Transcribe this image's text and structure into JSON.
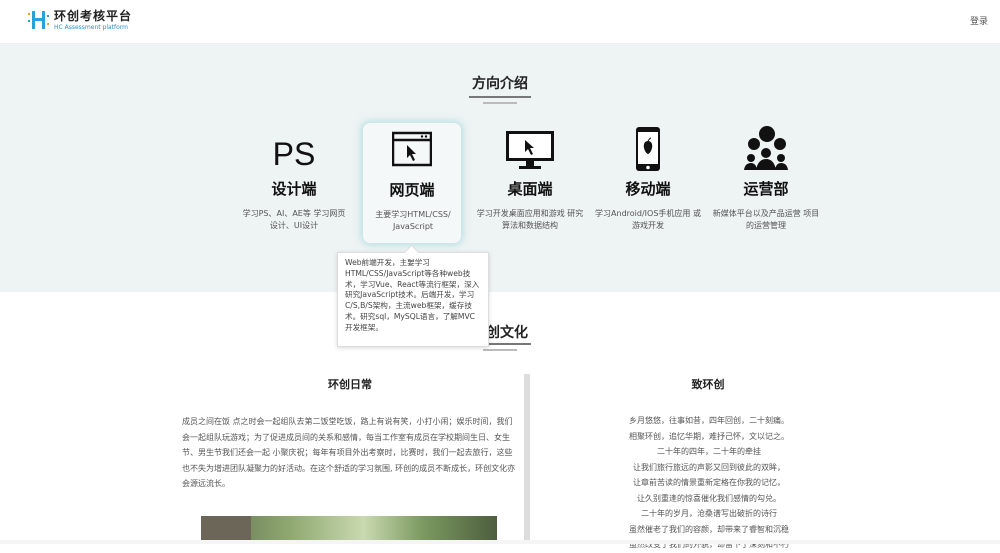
{
  "header": {
    "logo_title": "环创考核平台",
    "logo_subtitle": "HC Assessment platform",
    "login_label": "登录"
  },
  "direction": {
    "title": "方向介绍",
    "cards": [
      {
        "icon": "ps-text-icon",
        "icon_text": "PS",
        "name": "设计端",
        "desc": "学习PS、AI、AE等 学习网页设计、UI设计"
      },
      {
        "icon": "browser-window-icon",
        "name": "网页端",
        "desc": "主要学习HTML/CSS/ JavaScript"
      },
      {
        "icon": "desktop-monitor-icon",
        "name": "桌面端",
        "desc": "学习开发桌面应用和游戏 研究算法和数据结构"
      },
      {
        "icon": "mobile-phone-icon",
        "name": "移动端",
        "desc": "学习Android/IOS手机应用 或游戏开发"
      },
      {
        "icon": "people-chat-icon",
        "name": "运营部",
        "desc": "新媒体平台以及产品运营 项目的运营管理"
      }
    ],
    "tooltip": "Web前端开发，主要学习HTML/CSS/JavaScript等各种web技术，学习Vue、React等流行框架，深入研究JavaScript技术。后端开发，学习C/S,B/S架构，主流web框架，缓存技术。研究sql，MySQL语言，了解MVC开发框架。"
  },
  "culture": {
    "title": "环创文化",
    "left_title": "环创日常",
    "left_text": "成员之间在饭 点之时会一起组队去第二饭堂吃饭，路上有说有笑，小打小闹；娱乐时间，我们会一起组队玩游戏；为了促进成员间的关系和感情，每当工作室有成员在学校期间生日、女生节、男生节我们还会一起 小聚庆祝；每年有项目外出考察时，比赛时，我们一起去旅行，这些也不失为增进团队凝聚力的好活动。在这个舒适的学习氛围, 环创的成员不断成长，环创文化亦会源远流长。",
    "right_title": "致环创",
    "right_lines": [
      "乡月悠悠，往事如昔，四年回创，二十刻痛。",
      "相聚环创，追忆华期，难抒己怀，文以记之。",
      "二十年的四年，二十年的牵挂",
      "让我们旅行旅远的声影又回到彼此的双眸，",
      "让章前苦读的情景重新定格在你我的记忆，",
      "让久别重逢的惊喜催化我们感情的勾兑。",
      "二十年的岁月，沧桑谱写出破折的诗行",
      "虽然催老了我们的容颜，却带来了睿智和沉稳",
      "虽然改变了我们的外貌，却留下了深刻和不朽"
    ]
  }
}
